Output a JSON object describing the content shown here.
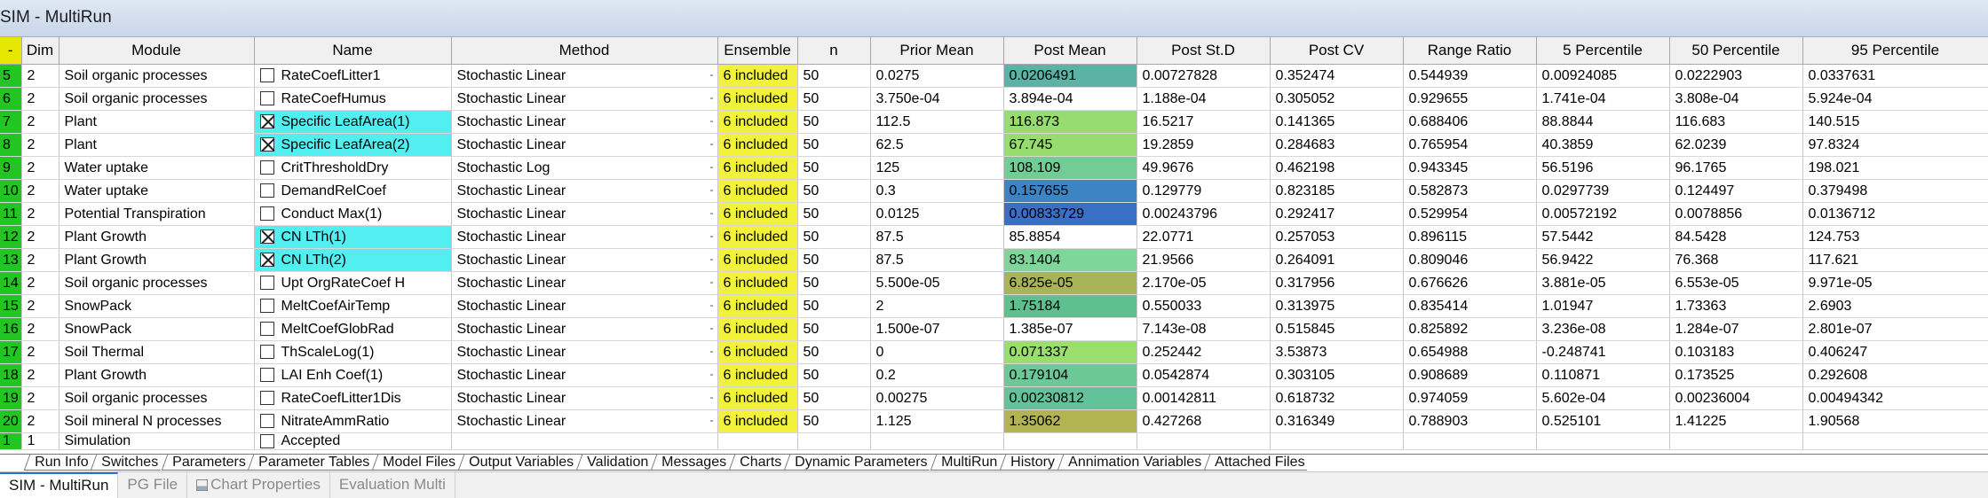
{
  "window": {
    "title": "SIM - MultiRun"
  },
  "columns": [
    {
      "key": "corner",
      "label": "-"
    },
    {
      "key": "dim",
      "label": "Dim"
    },
    {
      "key": "module",
      "label": "Module"
    },
    {
      "key": "name",
      "label": "Name"
    },
    {
      "key": "method",
      "label": "Method"
    },
    {
      "key": "ensemble",
      "label": "Ensemble"
    },
    {
      "key": "n",
      "label": "n"
    },
    {
      "key": "prior_mean",
      "label": "Prior Mean"
    },
    {
      "key": "post_mean",
      "label": "Post Mean"
    },
    {
      "key": "post_std",
      "label": "Post St.D"
    },
    {
      "key": "post_cv",
      "label": "Post CV"
    },
    {
      "key": "range_ratio",
      "label": "Range Ratio"
    },
    {
      "key": "p5",
      "label": "5 Percentile"
    },
    {
      "key": "p50",
      "label": "50 Percentile"
    },
    {
      "key": "p95",
      "label": "95 Percentile"
    }
  ],
  "rows": [
    {
      "row": "5",
      "dim": "2",
      "module": "Soil organic processes",
      "checked": false,
      "name": "RateCoefLitter1",
      "method": "Stochastic Linear",
      "ensemble": "6 included",
      "n": "50",
      "prior_mean": "0.0275",
      "post_mean": "0.0206491",
      "post_color": "#5bb3a6",
      "post_std": "0.00727828",
      "post_cv": "0.352474",
      "range_ratio": "0.544939",
      "p5": "0.00924085",
      "p50": "0.0222903",
      "p95": "0.0337631"
    },
    {
      "row": "6",
      "dim": "2",
      "module": "Soil organic processes",
      "checked": false,
      "name": "RateCoefHumus",
      "method": "Stochastic Linear",
      "ensemble": "6 included",
      "n": "50",
      "prior_mean": "3.750e-04",
      "post_mean": "3.894e-04",
      "post_color": "#ffffff",
      "post_std": "1.188e-04",
      "post_cv": "0.305052",
      "range_ratio": "0.929655",
      "p5": "1.741e-04",
      "p50": "3.808e-04",
      "p95": "5.924e-04"
    },
    {
      "row": "7",
      "dim": "2",
      "module": "Plant",
      "checked": true,
      "name": "Specific LeafArea(1)",
      "method": "Stochastic Linear",
      "ensemble": "6 included",
      "n": "50",
      "prior_mean": "112.5",
      "post_mean": "116.873",
      "post_color": "#96dc6e",
      "post_std": "16.5217",
      "post_cv": "0.141365",
      "range_ratio": "0.688406",
      "p5": "88.8844",
      "p50": "116.683",
      "p95": "140.515"
    },
    {
      "row": "8",
      "dim": "2",
      "module": "Plant",
      "checked": true,
      "name": "Specific LeafArea(2)",
      "method": "Stochastic Linear",
      "ensemble": "6 included",
      "n": "50",
      "prior_mean": "62.5",
      "post_mean": "67.745",
      "post_color": "#96dc6e",
      "post_std": "19.2859",
      "post_cv": "0.284683",
      "range_ratio": "0.765954",
      "p5": "40.3859",
      "p50": "62.0239",
      "p95": "97.8324"
    },
    {
      "row": "9",
      "dim": "2",
      "module": "Water uptake",
      "checked": false,
      "name": "CritThresholdDry",
      "method": "Stochastic Log",
      "ensemble": "6 included",
      "n": "50",
      "prior_mean": "125",
      "post_mean": "108.109",
      "post_color": "#72cc94",
      "post_std": "49.9676",
      "post_cv": "0.462198",
      "range_ratio": "0.943345",
      "p5": "56.5196",
      "p50": "96.1765",
      "p95": "198.021"
    },
    {
      "row": "10",
      "dim": "2",
      "module": "Water uptake",
      "checked": false,
      "name": "DemandRelCoef",
      "method": "Stochastic Linear",
      "ensemble": "6 included",
      "n": "50",
      "prior_mean": "0.3",
      "post_mean": "0.157655",
      "post_color": "#3c84c4",
      "post_std": "0.129779",
      "post_cv": "0.823185",
      "range_ratio": "0.582873",
      "p5": "0.0297739",
      "p50": "0.124497",
      "p95": "0.379498"
    },
    {
      "row": "11",
      "dim": "2",
      "module": "Potential Transpiration",
      "checked": false,
      "name": "Conduct Max(1)",
      "method": "Stochastic Linear",
      "ensemble": "6 included",
      "n": "50",
      "prior_mean": "0.0125",
      "post_mean": "0.00833729",
      "post_color": "#3a6fc8",
      "post_std": "0.00243796",
      "post_cv": "0.292417",
      "range_ratio": "0.529954",
      "p5": "0.00572192",
      "p50": "0.0078856",
      "p95": "0.0136712"
    },
    {
      "row": "12",
      "dim": "2",
      "module": "Plant Growth",
      "checked": true,
      "name": "CN LTh(1)",
      "method": "Stochastic Linear",
      "ensemble": "6 included",
      "n": "50",
      "prior_mean": "87.5",
      "post_mean": "85.8854",
      "post_color": "#ffffff",
      "post_std": "22.0771",
      "post_cv": "0.257053",
      "range_ratio": "0.896115",
      "p5": "57.5442",
      "p50": "84.5428",
      "p95": "124.753"
    },
    {
      "row": "13",
      "dim": "2",
      "module": "Plant Growth",
      "checked": true,
      "name": "CN LTh(2)",
      "method": "Stochastic Linear",
      "ensemble": "6 included",
      "n": "50",
      "prior_mean": "87.5",
      "post_mean": "83.1404",
      "post_color": "#7fd69a",
      "post_std": "21.9566",
      "post_cv": "0.264091",
      "range_ratio": "0.809046",
      "p5": "56.9422",
      "p50": "76.368",
      "p95": "117.621"
    },
    {
      "row": "14",
      "dim": "2",
      "module": "Soil organic processes",
      "checked": false,
      "name": "Upt OrgRateCoef H",
      "method": "Stochastic Linear",
      "ensemble": "6 included",
      "n": "50",
      "prior_mean": "5.500e-05",
      "post_mean": "6.825e-05",
      "post_color": "#a8b458",
      "post_std": "2.170e-05",
      "post_cv": "0.317956",
      "range_ratio": "0.676626",
      "p5": "3.881e-05",
      "p50": "6.553e-05",
      "p95": "9.971e-05"
    },
    {
      "row": "15",
      "dim": "2",
      "module": "SnowPack",
      "checked": false,
      "name": "MeltCoefAirTemp",
      "method": "Stochastic Linear",
      "ensemble": "6 included",
      "n": "50",
      "prior_mean": "2",
      "post_mean": "1.75184",
      "post_color": "#5dc08e",
      "post_std": "0.550033",
      "post_cv": "0.313975",
      "range_ratio": "0.835414",
      "p5": "1.01947",
      "p50": "1.73363",
      "p95": "2.6903"
    },
    {
      "row": "16",
      "dim": "2",
      "module": "SnowPack",
      "checked": false,
      "name": "MeltCoefGlobRad",
      "method": "Stochastic Linear",
      "ensemble": "6 included",
      "n": "50",
      "prior_mean": "1.500e-07",
      "post_mean": "1.385e-07",
      "post_color": "#ffffff",
      "post_std": "7.143e-08",
      "post_cv": "0.515845",
      "range_ratio": "0.825892",
      "p5": "3.236e-08",
      "p50": "1.284e-07",
      "p95": "2.801e-07"
    },
    {
      "row": "17",
      "dim": "2",
      "module": "Soil Thermal",
      "checked": false,
      "name": "ThScaleLog(1)",
      "method": "Stochastic Linear",
      "ensemble": "6 included",
      "n": "50",
      "prior_mean": "0",
      "post_mean": "0.071337",
      "post_color": "#9ade6e",
      "post_std": "0.252442",
      "post_cv": "3.53873",
      "range_ratio": "0.654988",
      "p5": "-0.248741",
      "p50": "0.103183",
      "p95": "0.406247"
    },
    {
      "row": "18",
      "dim": "2",
      "module": "Plant Growth",
      "checked": false,
      "name": "LAI Enh Coef(1)",
      "method": "Stochastic Linear",
      "ensemble": "6 included",
      "n": "50",
      "prior_mean": "0.2",
      "post_mean": "0.179104",
      "post_color": "#6cc896",
      "post_std": "0.0542874",
      "post_cv": "0.303105",
      "range_ratio": "0.908689",
      "p5": "0.110871",
      "p50": "0.173525",
      "p95": "0.292608"
    },
    {
      "row": "19",
      "dim": "2",
      "module": "Soil organic processes",
      "checked": false,
      "name": "RateCoefLitter1Dis",
      "method": "Stochastic Linear",
      "ensemble": "6 included",
      "n": "50",
      "prior_mean": "0.00275",
      "post_mean": "0.00230812",
      "post_color": "#62c29a",
      "post_std": "0.00142811",
      "post_cv": "0.618732",
      "range_ratio": "0.974059",
      "p5": "5.602e-04",
      "p50": "0.00236004",
      "p95": "0.00494342"
    },
    {
      "row": "20",
      "dim": "2",
      "module": "Soil mineral N processes",
      "checked": false,
      "name": "NitrateAmmRatio",
      "method": "Stochastic Linear",
      "ensemble": "6 included",
      "n": "50",
      "prior_mean": "1.125",
      "post_mean": "1.35062",
      "post_color": "#b2b454",
      "post_std": "0.427268",
      "post_cv": "0.316349",
      "range_ratio": "0.788903",
      "p5": "0.525101",
      "p50": "1.41225",
      "p95": "1.90568"
    }
  ],
  "last_row": {
    "row": "1",
    "dim": "1",
    "module": "Simulation",
    "name": "Accepted"
  },
  "sheet_tabs": [
    "Run Info",
    "Switches",
    "Parameters",
    "Parameter Tables",
    "Model Files",
    "Output Variables",
    "Validation",
    "Messages",
    "Charts",
    "Dynamic Parameters",
    "MultiRun",
    "History",
    "Annimation Variables",
    "Attached Files"
  ],
  "bottom_tabs": [
    {
      "label": "SIM - MultiRun",
      "active": true,
      "icon": ""
    },
    {
      "label": "PG File",
      "active": false,
      "icon": ""
    },
    {
      "label": "Chart Properties",
      "active": false,
      "icon": "chart-icon"
    },
    {
      "label": "Evaluation Multi",
      "active": false,
      "icon": ""
    }
  ],
  "colors": {
    "row_header": "#22c522",
    "ensemble": "#f2f23a",
    "selected_name": "#52eef0",
    "corner": "#e6e600"
  }
}
